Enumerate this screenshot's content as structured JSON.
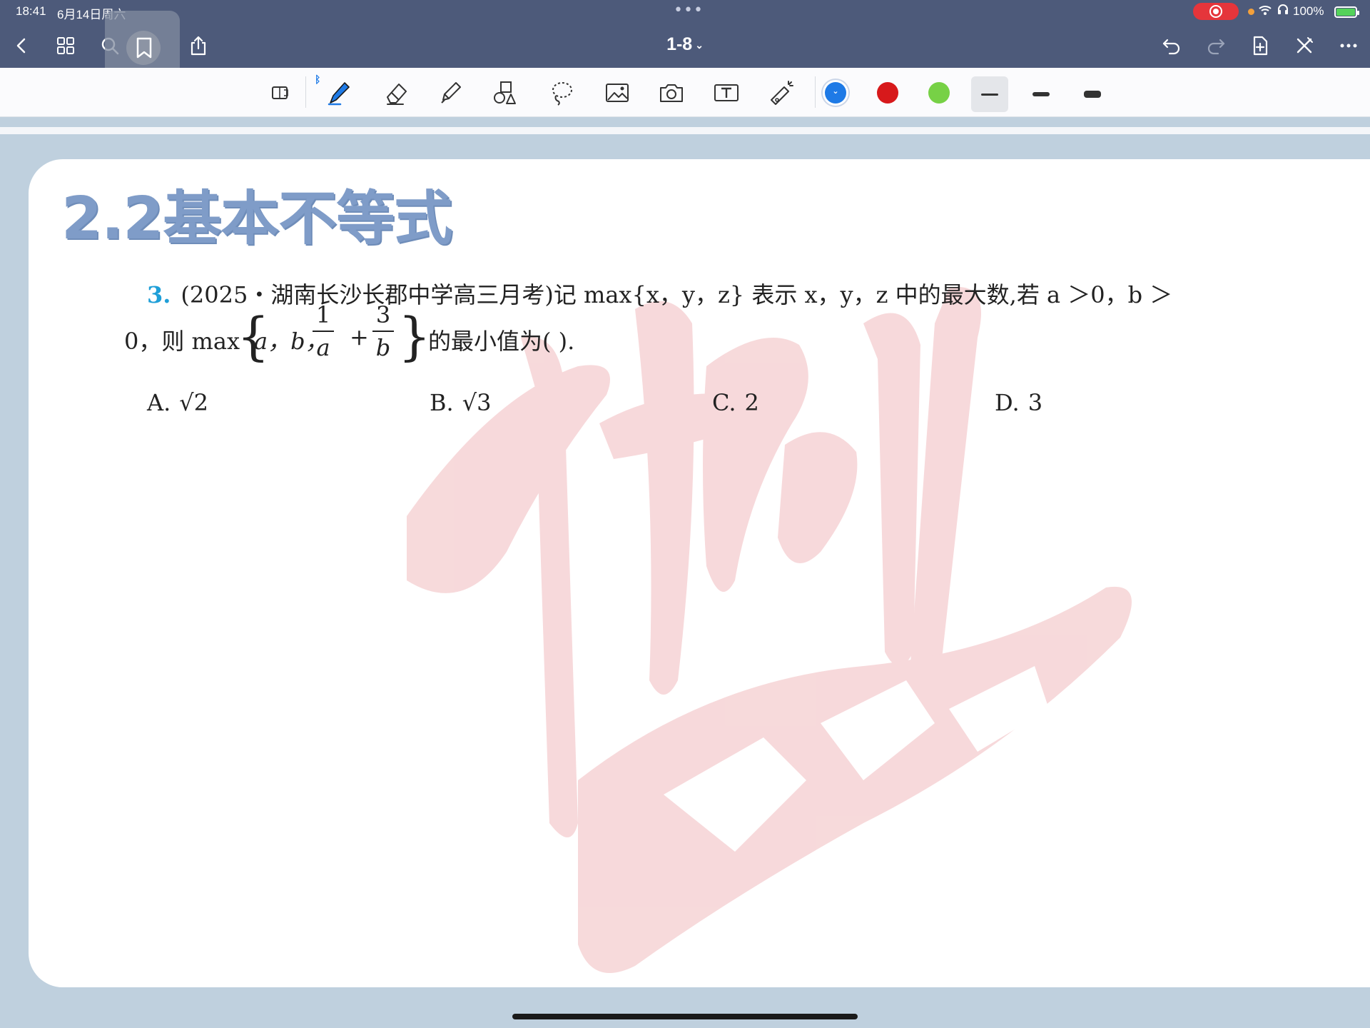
{
  "status_bar": {
    "time": "18:41",
    "date": "6月14日周六",
    "battery": "100%"
  },
  "nav": {
    "doc_title": "1-8"
  },
  "toolbar": {
    "colors": [
      "#1e7ae6",
      "#d7191b",
      "#77d146"
    ],
    "selected_color_index": 0,
    "stroke_widths": [
      "thin",
      "medium",
      "thick"
    ],
    "selected_stroke_index": 0
  },
  "page": {
    "chapter_title": "2.2基本不等式",
    "question": {
      "number": "3.",
      "line1": "(2025・湖南长沙长郡中学高三月考)记 max{x，y，z} 表示 x，y，z 中的最大数,若 a ＞0，b ＞",
      "line2_prefix": "0，则 max",
      "line2_vars": "a，b，",
      "frac1_num": "1",
      "frac1_den": "a",
      "plus": "+",
      "frac2_num": "3",
      "frac2_den": "b",
      "line2_suffix": "的最小值为(        )."
    },
    "options": [
      {
        "label": "A.",
        "value": "√2"
      },
      {
        "label": "B.",
        "value": "√3"
      },
      {
        "label": "C.",
        "value": "2"
      },
      {
        "label": "D.",
        "value": "3"
      }
    ]
  }
}
